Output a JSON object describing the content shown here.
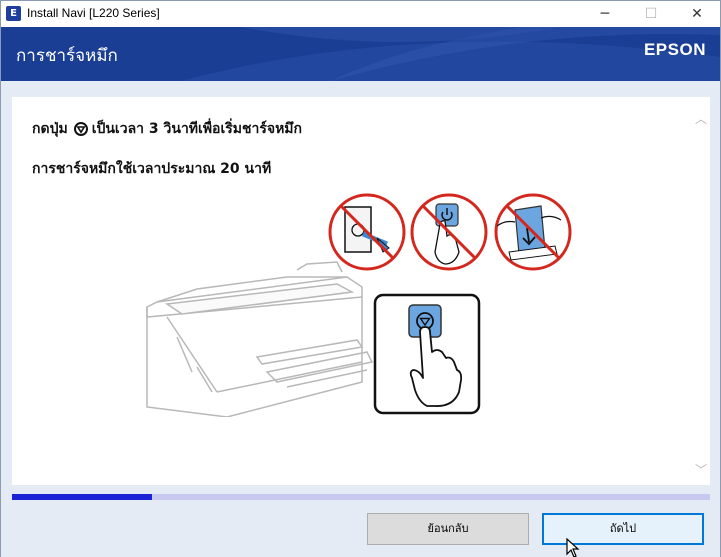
{
  "window": {
    "title": "Install Navi [L220 Series]",
    "app_icon_letter": "E",
    "minimize_glyph": "─",
    "maximize_glyph": "☐",
    "close_glyph": "✕"
  },
  "header": {
    "title": "การชาร์จหมึก",
    "brand": "EPSON"
  },
  "main": {
    "instruction_prefix": "กดปุ่ม",
    "instruction_suffix": "เป็นเวลา 3 วินาทีเพื่อเริ่มชาร์จหมึก",
    "duration_note": "การชาร์จหมึกใช้เวลาประมาณ 20 นาที",
    "scroll_up_glyph": "︿",
    "scroll_down_glyph": "﹀"
  },
  "progress": {
    "value": 0.2
  },
  "footer": {
    "back_label": "ย้อนกลับ",
    "next_label": "ถัดไป"
  },
  "colors": {
    "header_bg": "#1a3e94",
    "progress_fill": "#1a24d6",
    "prohibit_red": "#d4281e",
    "button_blue": "#6ba6e0"
  },
  "icons": [
    "stop-button-icon",
    "no-unplug-icon",
    "no-power-icon",
    "no-paper-icon",
    "printer-illustration",
    "press-hand-icon"
  ]
}
